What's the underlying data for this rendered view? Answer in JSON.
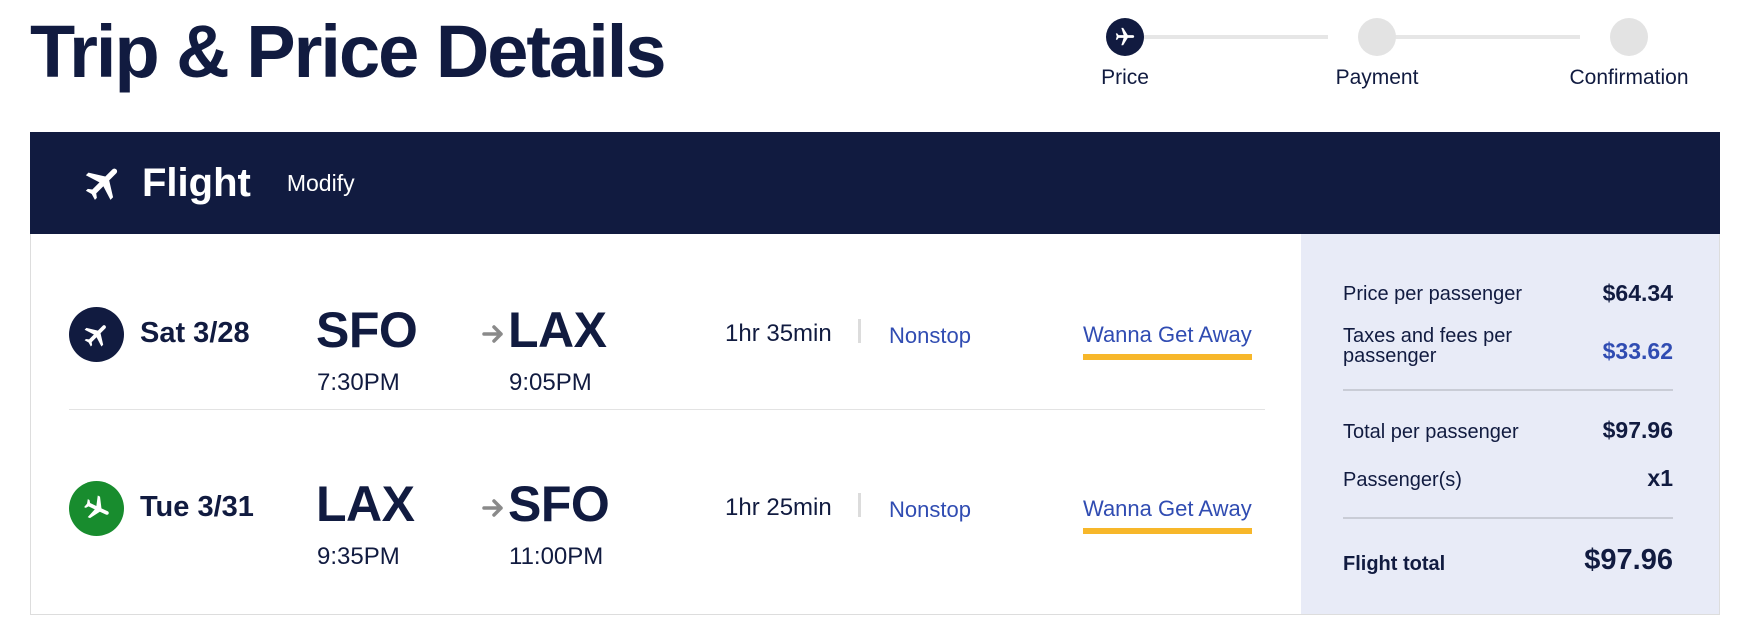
{
  "page": {
    "title": "Trip & Price Details"
  },
  "stepper": {
    "steps": [
      {
        "label": "Price",
        "active": true
      },
      {
        "label": "Payment",
        "active": false
      },
      {
        "label": "Confirmation",
        "active": false
      }
    ]
  },
  "flight_bar": {
    "title": "Flight",
    "modify_label": "Modify",
    "icon": "airplane-icon"
  },
  "legs": [
    {
      "date": "Sat 3/28",
      "icon": "departing-plane-icon",
      "from": {
        "code": "SFO",
        "time": "7:30PM"
      },
      "to": {
        "code": "LAX",
        "time": "9:05PM"
      },
      "duration": "1hr 35min",
      "stops": "Nonstop",
      "fare": "Wanna Get Away"
    },
    {
      "date": "Tue 3/31",
      "icon": "returning-plane-icon",
      "from": {
        "code": "LAX",
        "time": "9:35PM"
      },
      "to": {
        "code": "SFO",
        "time": "11:00PM"
      },
      "duration": "1hr 25min",
      "stops": "Nonstop",
      "fare": "Wanna Get Away"
    }
  ],
  "price_summary": {
    "price_per_passenger": {
      "label": "Price per passenger",
      "value": "$64.34"
    },
    "taxes_per_passenger": {
      "label": "Taxes and fees per passenger",
      "value": "$33.62"
    },
    "total_per_passenger": {
      "label": "Total per passenger",
      "value": "$97.96"
    },
    "passengers": {
      "label": "Passenger(s)",
      "value": "x1"
    },
    "flight_total": {
      "label": "Flight total",
      "value": "$97.96"
    }
  },
  "colors": {
    "navy": "#111b40",
    "link_blue": "#304cb2",
    "fare_underline": "#f7b72a",
    "return_green": "#188c2e",
    "panel_bg": "#e8ebf7"
  }
}
